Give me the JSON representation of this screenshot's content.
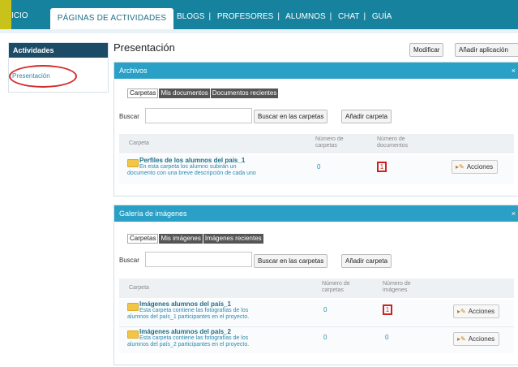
{
  "nav": {
    "inicio": "ICIO",
    "active_tab": "PÁGINAS DE ACTIVIDADES",
    "links": [
      "BLOGS",
      "PROFESORES",
      "ALUMNOS",
      "CHAT",
      "GUÍA"
    ]
  },
  "sidebar": {
    "header": "Actividades",
    "item": "Presentación"
  },
  "page": {
    "title": "Presentación",
    "modify_label": "Modificar",
    "add_app_label": "Añadir aplicación"
  },
  "archivos": {
    "title": "Archivos",
    "close": "×",
    "tabs": [
      "Carpetas",
      "Mis documentos",
      "Documentos recientes"
    ],
    "search_label": "Buscar",
    "search_value": "",
    "search_button": "Buscar en las carpetas",
    "add_button": "Añadir carpeta",
    "columns": {
      "folder": "Carpeta",
      "num_folders_1": "Número de",
      "num_folders_2": "carpetas",
      "num_docs_1": "Número de",
      "num_docs_2": "documentos"
    },
    "rows": [
      {
        "name": "Perfiles de los alumnos del país_1",
        "desc1": "En esta carpeta los alumno subirán un",
        "desc2": "documento con una breve descripción de cada uno",
        "folders": "0",
        "items": "1",
        "actions": "Acciones"
      }
    ]
  },
  "galeria": {
    "title": "Galería de imágenes",
    "close": "×",
    "tabs": [
      "Carpetas",
      "Mis imágenes",
      "Imágenes recientes"
    ],
    "search_label": "Buscar",
    "search_value": "",
    "search_button": "Buscar en las carpetas",
    "add_button": "Añadir carpeta",
    "columns": {
      "folder": "Carpeta",
      "num_folders_1": "Número de",
      "num_folders_2": "carpetas",
      "num_imgs_1": "Número de",
      "num_imgs_2": "imágenes"
    },
    "rows": [
      {
        "name": "Imágenes alumnos del país_1",
        "desc1": "Esta carpeta contiene las fotografías de los",
        "desc2": "alumnos del país_1 participantes en el proyecto.",
        "folders": "0",
        "items": "1",
        "actions": "Acciones"
      },
      {
        "name": "Imágenes alumnos del país_2",
        "desc1": "Esta carpeta contiene las fotografías de los",
        "desc2": "alumnos del país_2 participantes en el proyecto.",
        "folders": "0",
        "items": "0",
        "actions": "Acciones"
      }
    ]
  },
  "colors": {
    "topbar": "#17829e",
    "panel_header": "#2aa0c6",
    "sidebar_header": "#1c4b66",
    "highlight": "#cc2222"
  }
}
